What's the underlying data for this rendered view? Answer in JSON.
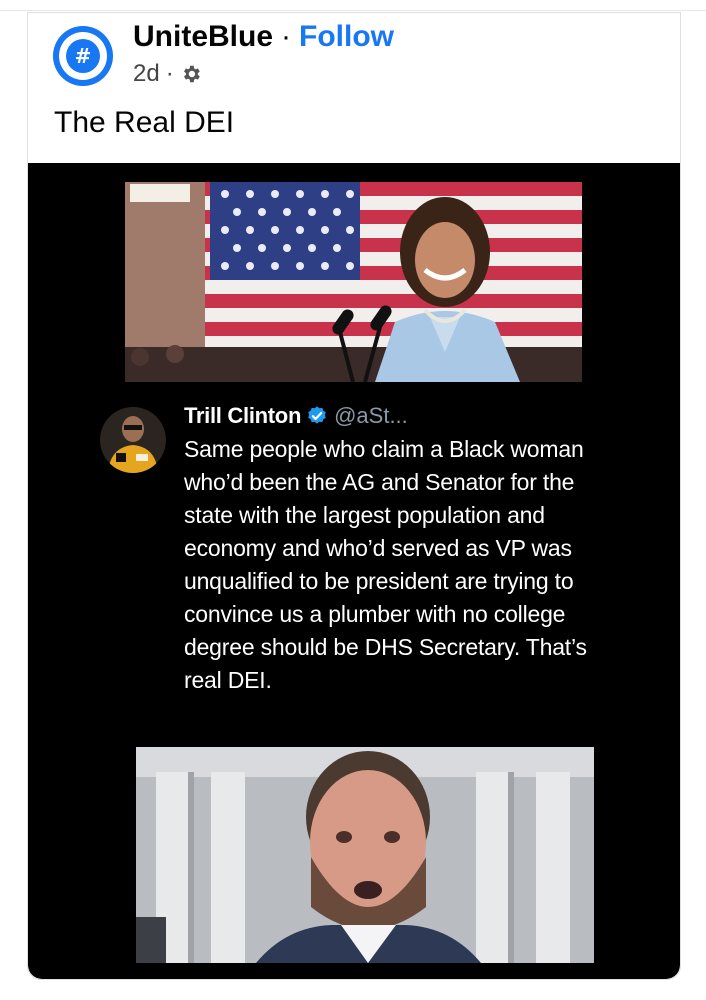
{
  "post": {
    "group_name": "UniteBlue",
    "separator": "·",
    "follow_label": "Follow",
    "time": "2d",
    "meta_sep": "·",
    "caption": "The Real DEI"
  },
  "tweet": {
    "author": "Trill Clinton",
    "handle": "@aSt...",
    "text": "Same people who claim a Black woman who’d been the AG and Senator for the state with the largest population and economy and who’d served as VP was unqualified to be president are trying to convince us a plumber with no college degree should be DHS Secretary. That’s real DEI."
  },
  "icons": {
    "group_avatar": "group-hashtag-icon",
    "privacy": "gear-icon",
    "verified": "verified-badge-icon"
  },
  "colors": {
    "accent": "#1877f2",
    "media_background": "#000000",
    "handle_gray": "#8b98a5"
  }
}
